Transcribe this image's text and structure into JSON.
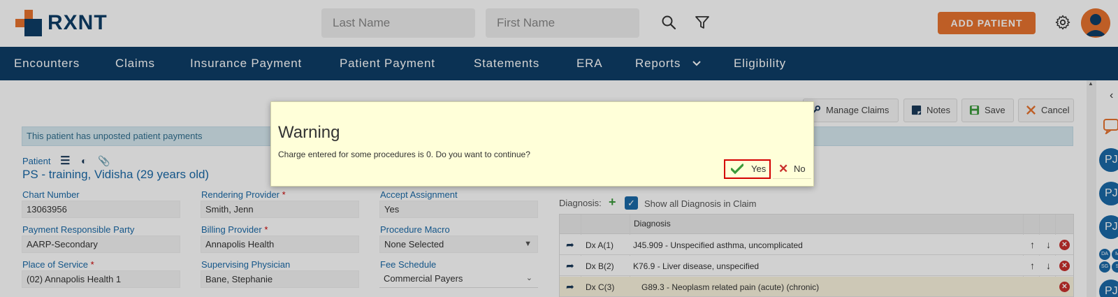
{
  "header": {
    "logo_text": "RXNT",
    "last_name_placeholder": "Last Name",
    "first_name_placeholder": "First Name",
    "add_patient_label": "ADD PATIENT",
    "brand_color": "#e8732f",
    "navy_color": "#0e3d67"
  },
  "nav": {
    "items": [
      "Encounters",
      "Claims",
      "Insurance Payment",
      "Patient Payment",
      "Statements",
      "ERA",
      "Reports",
      "Eligibility"
    ]
  },
  "toolbar": {
    "manage_claims": "Manage Claims",
    "notes": "Notes",
    "save": "Save",
    "cancel": "Cancel"
  },
  "alert": "This patient has unposted patient payments",
  "patient": {
    "label": "Patient",
    "name": "PS - training, Vidisha (29 years old)"
  },
  "form": {
    "chart_number": {
      "label": "Chart Number",
      "value": "13063956"
    },
    "rendering_provider": {
      "label": "Rendering Provider",
      "value": "Smith, Jenn"
    },
    "accept_assignment": {
      "label": "Accept Assignment",
      "value": "Yes"
    },
    "payment_responsible_party": {
      "label": "Payment Responsible Party",
      "value": "AARP-Secondary"
    },
    "billing_provider": {
      "label": "Billing Provider",
      "value": "Annapolis Health"
    },
    "procedure_macro": {
      "label": "Procedure Macro",
      "value": "None Selected"
    },
    "place_of_service": {
      "label": "Place of Service",
      "value": "(02) Annapolis Health 1"
    },
    "supervising_physician": {
      "label": "Supervising Physician",
      "value": "Bane, Stephanie"
    },
    "fee_schedule": {
      "label": "Fee Schedule",
      "value": "Commercial Payers"
    },
    "required_mark": "*"
  },
  "diagnosis": {
    "label": "Diagnosis:",
    "show_all_label": "Show all Diagnosis in Claim",
    "column_header": "Diagnosis",
    "rows": [
      {
        "dx": "Dx A(1)",
        "desc": "J45.909 - Unspecified asthma, uncomplicated"
      },
      {
        "dx": "Dx B(2)",
        "desc": "K76.9 - Liver disease, unspecified"
      },
      {
        "dx": "Dx C(3)",
        "desc": "G89.3 - Neoplasm related pain (acute) (chronic)"
      }
    ]
  },
  "side_panel": {
    "avatars": [
      "PJ",
      "PJ",
      "PJ",
      "PJ"
    ],
    "small_avatars": [
      "DA",
      "M",
      "SG",
      "S"
    ]
  },
  "dialog": {
    "title": "Warning",
    "message": "Charge entered for some procedures is 0. Do you want to continue?",
    "yes_label": "Yes",
    "no_label": "No"
  }
}
